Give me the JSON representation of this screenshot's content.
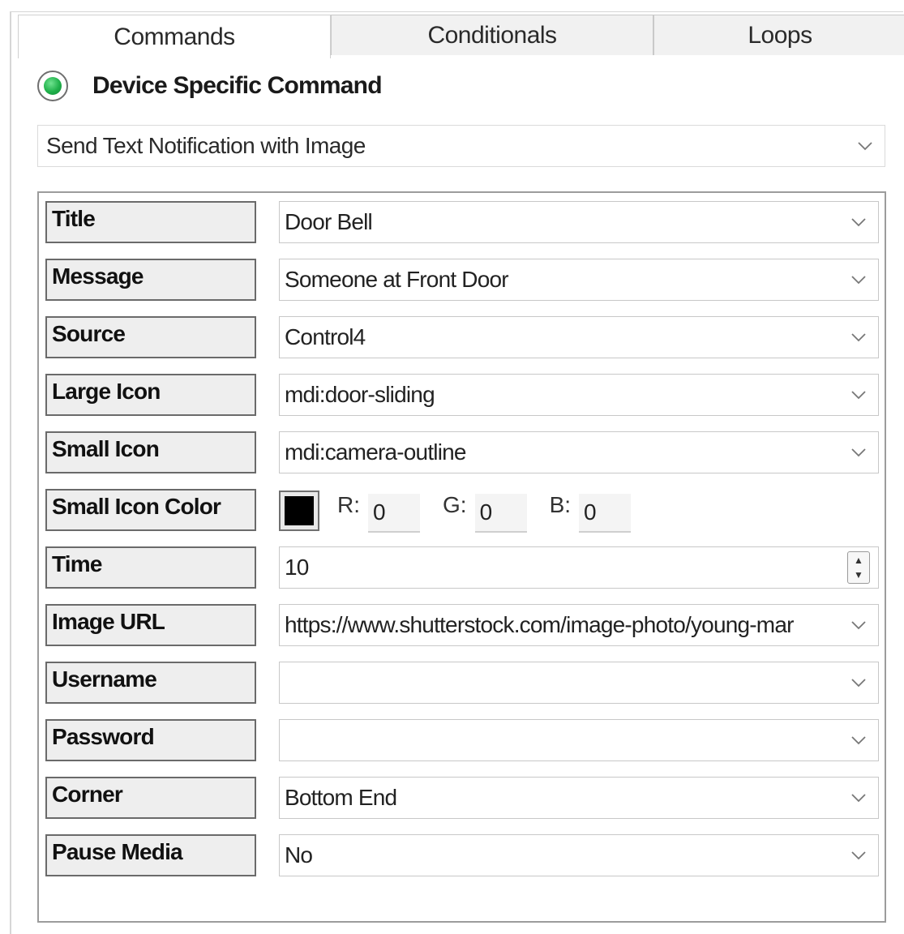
{
  "tabs": [
    {
      "label": "Commands",
      "active": true
    },
    {
      "label": "Conditionals",
      "active": false
    },
    {
      "label": "Loops",
      "active": false
    }
  ],
  "mode": {
    "label": "Device Specific Command",
    "selected": true,
    "accent_color": "#1fb04a"
  },
  "command_select": {
    "value": "Send Text Notification with Image",
    "icon": "chevron-down-icon"
  },
  "fields": {
    "title": {
      "label": "Title",
      "value": "Door Bell"
    },
    "message": {
      "label": "Message",
      "value": "Someone at Front Door"
    },
    "source": {
      "label": "Source",
      "value": "Control4"
    },
    "large_icon": {
      "label": "Large Icon",
      "value": "mdi:door-sliding"
    },
    "small_icon": {
      "label": "Small Icon",
      "value": "mdi:camera-outline"
    },
    "small_icon_color": {
      "label": "Small Icon Color",
      "swatch_color": "#000000",
      "r_label": "R:",
      "r_value": "0",
      "g_label": "G:",
      "g_value": "0",
      "b_label": "B:",
      "b_value": "0"
    },
    "time": {
      "label": "Time",
      "value": "10"
    },
    "image_url": {
      "label": "Image URL",
      "value": "https://www.shutterstock.com/image-photo/young-mar"
    },
    "username": {
      "label": "Username",
      "value": ""
    },
    "password": {
      "label": "Password",
      "value": ""
    },
    "corner": {
      "label": "Corner",
      "value": "Bottom End"
    },
    "pause_media": {
      "label": "Pause Media",
      "value": "No"
    }
  }
}
